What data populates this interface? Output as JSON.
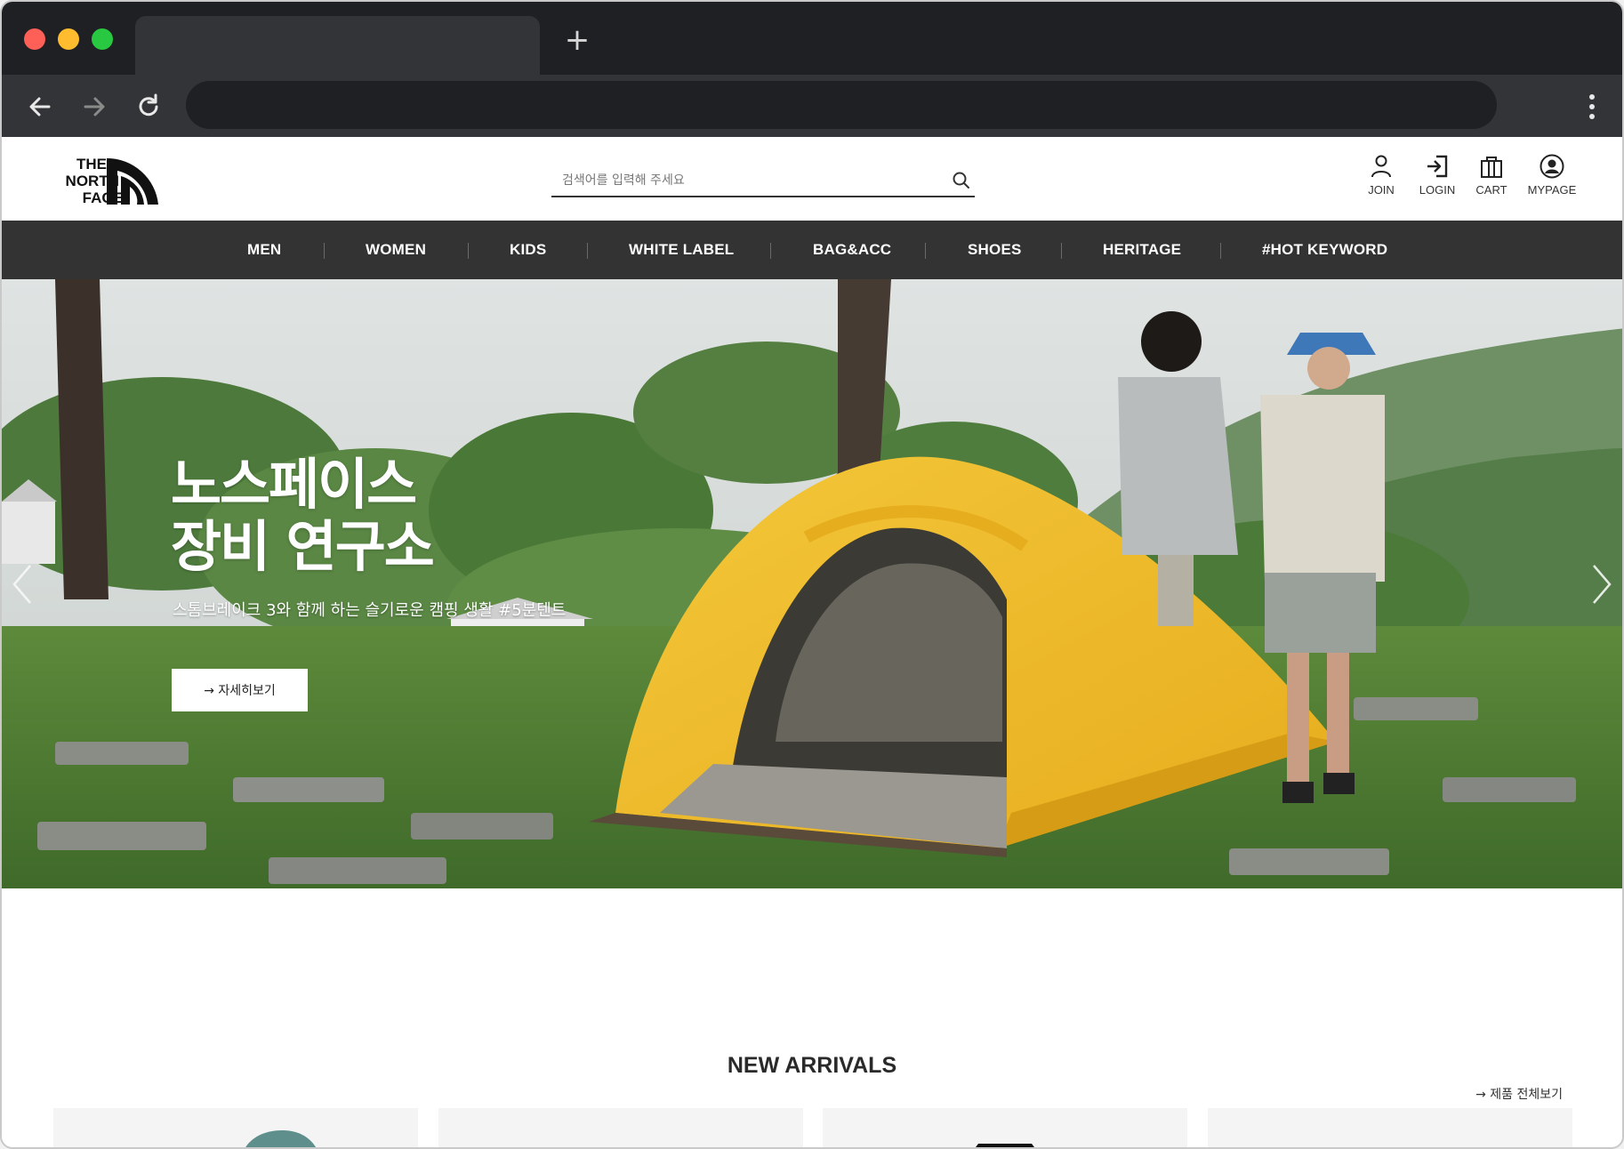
{
  "browser": {
    "address_value": "",
    "new_tab_symbol": "+"
  },
  "header": {
    "logo_lines": [
      "THE",
      "NORTH",
      "FACE"
    ],
    "search_placeholder": "검색어를 입력해 주세요",
    "utils": [
      {
        "label": "JOIN",
        "icon": "person-icon"
      },
      {
        "label": "LOGIN",
        "icon": "login-icon"
      },
      {
        "label": "CART",
        "icon": "shopping-bag-icon"
      },
      {
        "label": "MYPAGE",
        "icon": "account-circle-icon"
      }
    ]
  },
  "nav": {
    "items": [
      "MEN",
      "WOMEN",
      "KIDS",
      "WHITE LABEL",
      "BAG&ACC",
      "SHOES",
      "HERITAGE",
      "#HOT KEYWORD"
    ]
  },
  "hero": {
    "title_line1": "노스페이스",
    "title_line2": "장비 연구소",
    "subtitle": "스톰브레이크 3와 함께 하는 슬기로운 캠핑 생활 #5분텐트",
    "button_label": "→ 자세히보기"
  },
  "arrivals": {
    "title": "NEW ARRIVALS",
    "view_all": "→ 제품 전체보기"
  },
  "colors": {
    "tab_bg": "#1f2023",
    "toolbar_bg": "#323437",
    "nav_bg": "#333333",
    "tent_yellow": "#f2c230"
  }
}
